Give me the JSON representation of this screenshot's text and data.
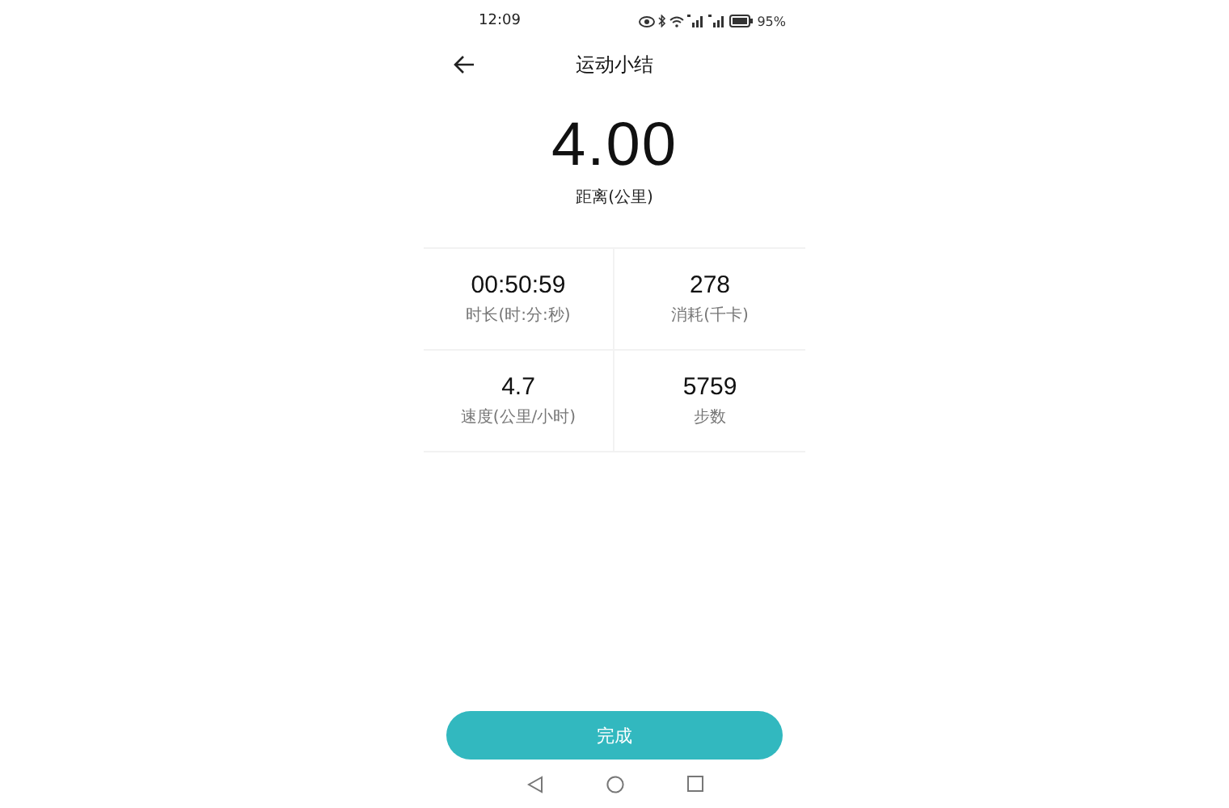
{
  "status_bar": {
    "time": "12:09",
    "battery": "95%"
  },
  "header": {
    "title": "运动小结"
  },
  "summary": {
    "value": "4.00",
    "label": "距离(公里)"
  },
  "stats": [
    {
      "value": "00:50:59",
      "label": "时长(时:分:秒)"
    },
    {
      "value": "278",
      "label": "消耗(千卡)"
    },
    {
      "value": "4.7",
      "label": "速度(公里/小时)"
    },
    {
      "value": "5759",
      "label": "步数"
    }
  ],
  "done_button": "完成"
}
